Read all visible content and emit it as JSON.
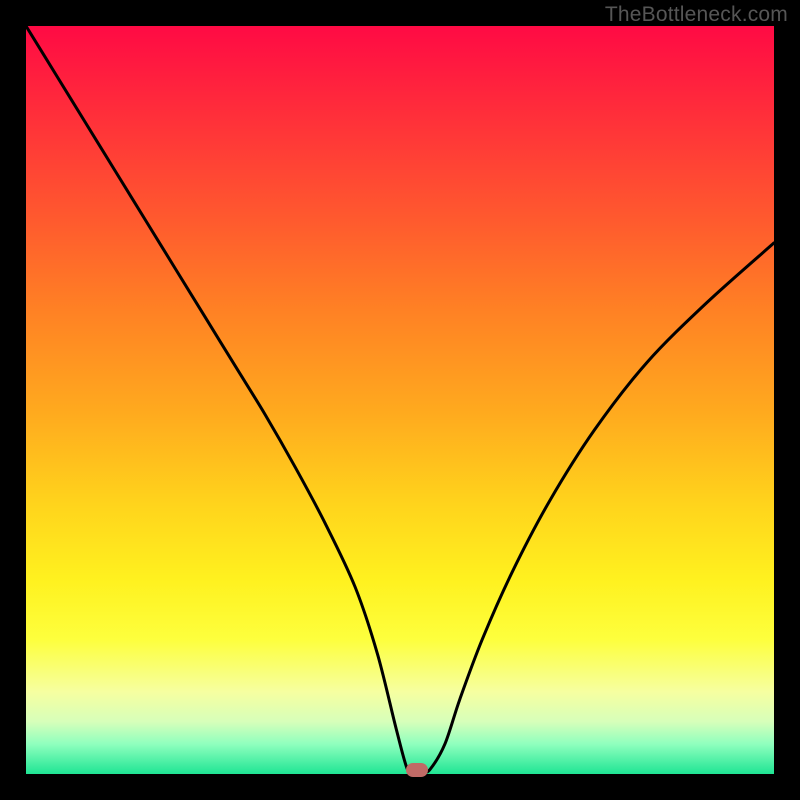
{
  "watermark": "TheBottleneck.com",
  "chart_data": {
    "type": "line",
    "title": "",
    "xlabel": "",
    "ylabel": "",
    "xlim": [
      0,
      100
    ],
    "ylim": [
      0,
      100
    ],
    "grid": false,
    "legend": false,
    "series": [
      {
        "name": "bottleneck-curve",
        "x": [
          0,
          4,
          8,
          12,
          16,
          20,
          24,
          28,
          32,
          36,
          40,
          44,
          47,
          49.5,
          51,
          52,
          53,
          54,
          56,
          58,
          61,
          65,
          70,
          76,
          83,
          91,
          100
        ],
        "y": [
          100,
          93.5,
          87,
          80.5,
          74,
          67.5,
          61,
          54.5,
          48,
          41,
          33.5,
          25,
          16,
          6,
          0.6,
          0.3,
          0.3,
          0.6,
          4,
          10,
          18,
          27,
          36.5,
          46,
          55,
          63,
          71
        ],
        "color": "#000000"
      }
    ],
    "background_gradient": {
      "direction": "vertical",
      "stops": [
        {
          "pos": 0.0,
          "color": "#ff0a44"
        },
        {
          "pos": 0.5,
          "color": "#ffab1e"
        },
        {
          "pos": 0.8,
          "color": "#fdff3d"
        },
        {
          "pos": 1.0,
          "color": "#1fe594"
        }
      ]
    },
    "marker": {
      "x": 52.3,
      "y": 0.5,
      "color": "#c06a66"
    }
  }
}
